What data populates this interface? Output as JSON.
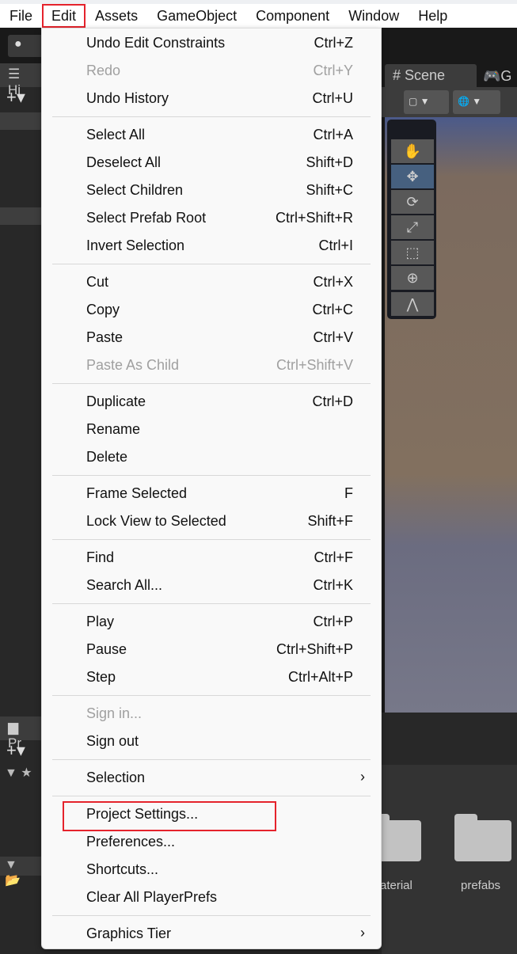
{
  "menubar": [
    "File",
    "Edit",
    "Assets",
    "GameObject",
    "Component",
    "Window",
    "Help"
  ],
  "active_menu": "Edit",
  "hierarchy_tab": "Hi",
  "project_tab": "Pr",
  "scene_tab": "Scene",
  "game_tab": "G",
  "folders": [
    "aterial",
    "prefabs"
  ],
  "highlight_color": "#e5232c",
  "menu": [
    {
      "label": "Undo Edit Constraints",
      "shortcut": "Ctrl+Z"
    },
    {
      "label": "Redo",
      "shortcut": "Ctrl+Y",
      "disabled": true
    },
    {
      "label": "Undo History",
      "shortcut": "Ctrl+U"
    },
    {
      "sep": true
    },
    {
      "label": "Select All",
      "shortcut": "Ctrl+A"
    },
    {
      "label": "Deselect All",
      "shortcut": "Shift+D"
    },
    {
      "label": "Select Children",
      "shortcut": "Shift+C"
    },
    {
      "label": "Select Prefab Root",
      "shortcut": "Ctrl+Shift+R"
    },
    {
      "label": "Invert Selection",
      "shortcut": "Ctrl+I"
    },
    {
      "sep": true
    },
    {
      "label": "Cut",
      "shortcut": "Ctrl+X"
    },
    {
      "label": "Copy",
      "shortcut": "Ctrl+C"
    },
    {
      "label": "Paste",
      "shortcut": "Ctrl+V"
    },
    {
      "label": "Paste As Child",
      "shortcut": "Ctrl+Shift+V",
      "disabled": true
    },
    {
      "sep": true
    },
    {
      "label": "Duplicate",
      "shortcut": "Ctrl+D"
    },
    {
      "label": "Rename",
      "shortcut": ""
    },
    {
      "label": "Delete",
      "shortcut": ""
    },
    {
      "sep": true
    },
    {
      "label": "Frame Selected",
      "shortcut": "F"
    },
    {
      "label": "Lock View to Selected",
      "shortcut": "Shift+F"
    },
    {
      "sep": true
    },
    {
      "label": "Find",
      "shortcut": "Ctrl+F"
    },
    {
      "label": "Search All...",
      "shortcut": "Ctrl+K"
    },
    {
      "sep": true
    },
    {
      "label": "Play",
      "shortcut": "Ctrl+P"
    },
    {
      "label": "Pause",
      "shortcut": "Ctrl+Shift+P"
    },
    {
      "label": "Step",
      "shortcut": "Ctrl+Alt+P"
    },
    {
      "sep": true
    },
    {
      "label": "Sign in...",
      "shortcut": "",
      "disabled": true
    },
    {
      "label": "Sign out",
      "shortcut": ""
    },
    {
      "sep": true
    },
    {
      "label": "Selection",
      "shortcut": "",
      "submenu": true
    },
    {
      "sep": true
    },
    {
      "label": "Project Settings...",
      "shortcut": "",
      "highlighted": true
    },
    {
      "label": "Preferences...",
      "shortcut": ""
    },
    {
      "label": "Shortcuts...",
      "shortcut": ""
    },
    {
      "label": "Clear All PlayerPrefs",
      "shortcut": ""
    },
    {
      "sep": true
    },
    {
      "label": "Graphics Tier",
      "shortcut": "",
      "submenu": true
    }
  ]
}
